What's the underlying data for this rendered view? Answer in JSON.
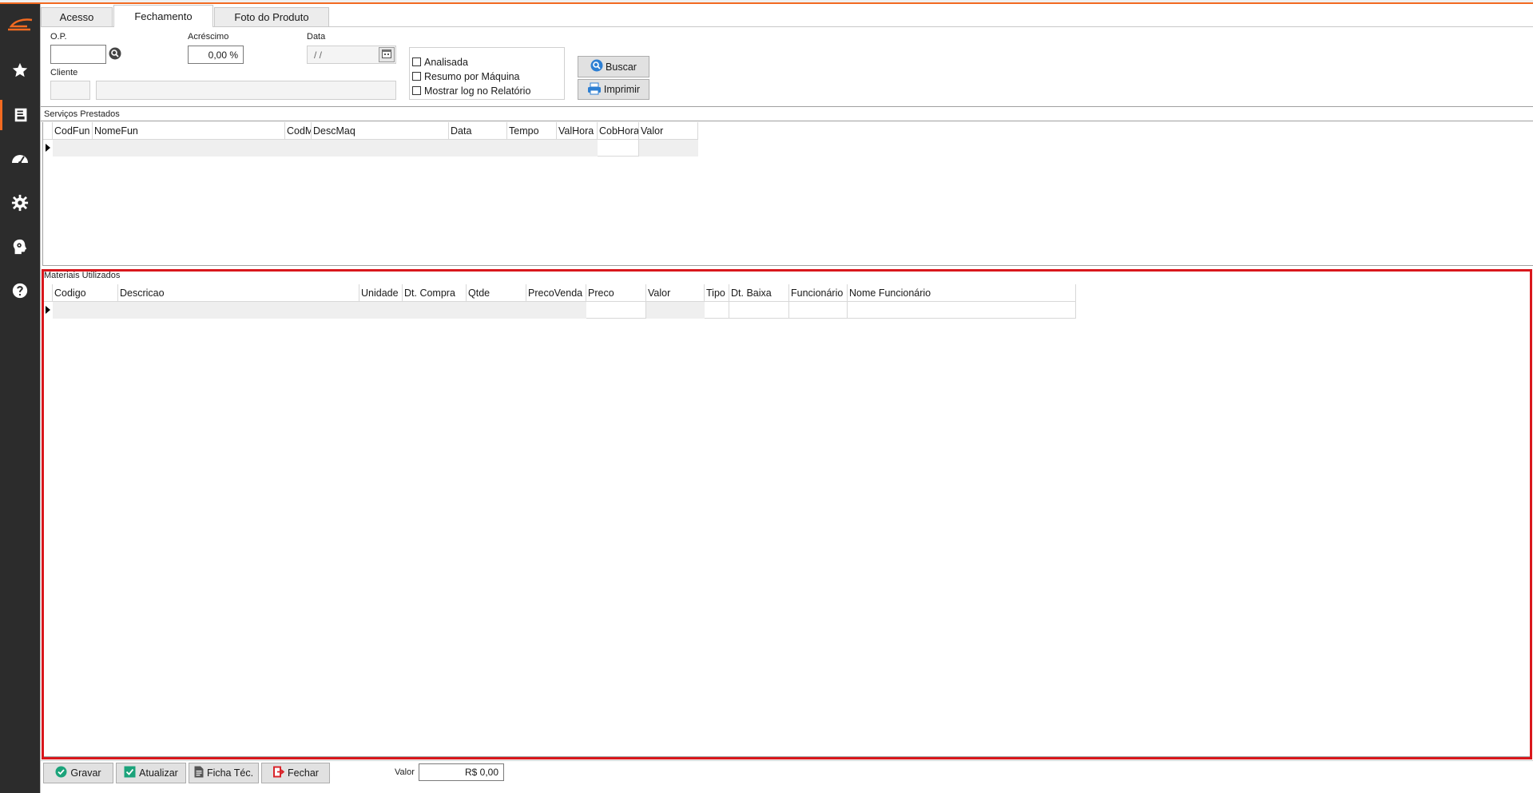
{
  "tabs": [
    {
      "label": "Acesso"
    },
    {
      "label": "Fechamento"
    },
    {
      "label": "Foto do Produto"
    }
  ],
  "filters": {
    "op_label": "O.P.",
    "op_value": "",
    "acrescimo_label": "Acréscimo",
    "acrescimo_value": "0,00 %",
    "data_label": "Data",
    "data_value": " /  /",
    "cliente_label": "Cliente",
    "cliente_code": "",
    "cliente_name": ""
  },
  "options": {
    "analisada": "Analisada",
    "resumo": "Resumo por Máquina",
    "mostrar_log": "Mostrar log no Relatório"
  },
  "actions": {
    "buscar": "Buscar",
    "imprimir": "Imprimir"
  },
  "servicos": {
    "title": "Serviços Prestados",
    "columns": [
      "CodFun",
      "NomeFun",
      "CodM",
      "DescMaq",
      "Data",
      "Tempo",
      "ValHora",
      "CobHora",
      "Valor"
    ]
  },
  "materiais": {
    "title": "Materiais Utilizados",
    "columns": [
      "Codigo",
      "Descricao",
      "Unidade",
      "Dt. Compra",
      "Qtde",
      "PrecoVenda",
      "Preco",
      "Valor",
      "Tipo",
      "Dt. Baixa",
      "Funcionário",
      "Nome Funcionário"
    ]
  },
  "footer": {
    "gravar": "Gravar",
    "atualizar": "Atualizar",
    "ficha": "Ficha Téc.",
    "fechar": "Fechar",
    "valor_label": "Valor",
    "valor_value": "R$ 0,00"
  },
  "colors": {
    "accent": "#f26a21",
    "sidebar": "#2c2c2c",
    "highlight": "#d9171c"
  },
  "sidebar_icons": [
    "logo-icon",
    "star-icon",
    "document-icon",
    "speedometer-icon",
    "gear-icon",
    "head-gear-icon",
    "help-icon"
  ]
}
